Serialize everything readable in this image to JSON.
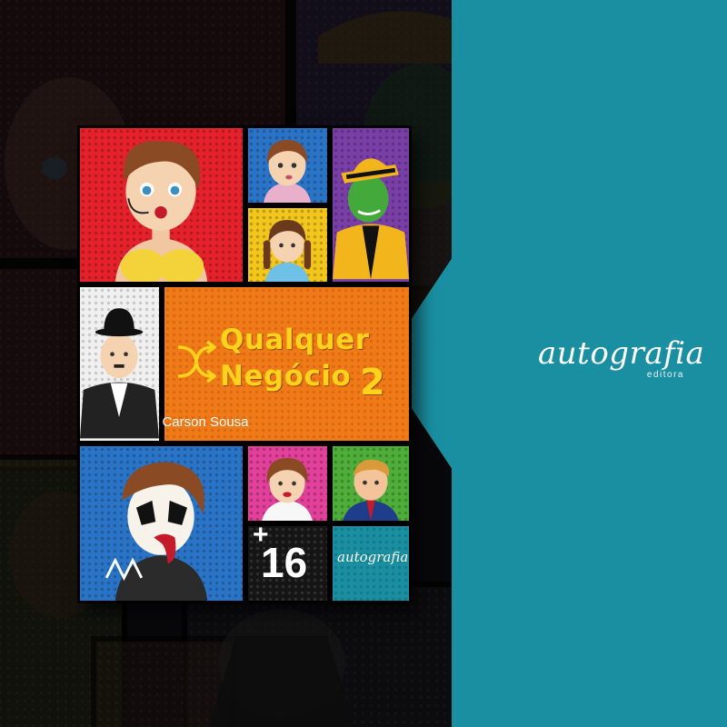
{
  "cover": {
    "title_line1": "Qualquer",
    "title_line2": "Negócio",
    "title_number": "2",
    "author": "Carson Sousa",
    "age_plus": "+",
    "age_number": "16",
    "publisher": "autografia"
  },
  "brand": {
    "name": "autografia",
    "subtitle": "editora"
  },
  "colors": {
    "teal": "#1a8fa1",
    "title_yellow": "#ffd21c",
    "orange_panel": "#f07a17",
    "red_panel": "#e5212b",
    "blue_panel": "#2a74c7",
    "purple_panel": "#7a3fa6"
  },
  "icons": {
    "cover_brand_arrows": "title-arrows-icon"
  }
}
